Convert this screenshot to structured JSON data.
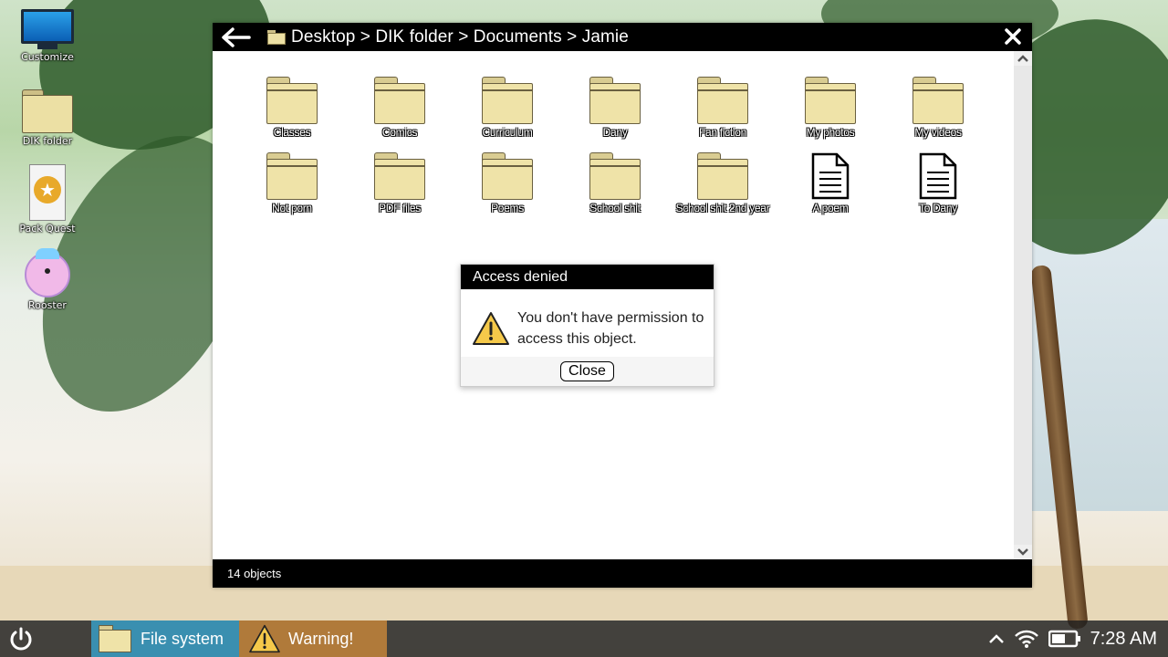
{
  "desktop": {
    "icons": [
      {
        "label": "Customize",
        "icon": "monitor-icon"
      },
      {
        "label": "DIK folder",
        "icon": "folder-icon"
      },
      {
        "label": "Pack Quest",
        "icon": "pack-quest-icon"
      },
      {
        "label": "Rooster",
        "icon": "rooster-icon"
      }
    ]
  },
  "window": {
    "breadcrumb": "Desktop > DIK folder > Documents > Jamie",
    "status": "14 objects",
    "items": [
      {
        "name": "Classes",
        "type": "folder"
      },
      {
        "name": "Comics",
        "type": "folder"
      },
      {
        "name": "Curriculum",
        "type": "folder"
      },
      {
        "name": "Dany",
        "type": "folder"
      },
      {
        "name": "Fan fiction",
        "type": "folder"
      },
      {
        "name": "My photos",
        "type": "folder"
      },
      {
        "name": "My videos",
        "type": "folder"
      },
      {
        "name": "Not porn",
        "type": "folder"
      },
      {
        "name": "PDF files",
        "type": "folder"
      },
      {
        "name": "Poems",
        "type": "folder"
      },
      {
        "name": "School shit",
        "type": "folder"
      },
      {
        "name": "School shit 2nd year",
        "type": "folder"
      },
      {
        "name": "A poem",
        "type": "document"
      },
      {
        "name": "To Dany",
        "type": "document"
      }
    ]
  },
  "dialog": {
    "title": "Access denied",
    "message": "You don't have permission to access this object.",
    "close_label": "Close"
  },
  "taskbar": {
    "tasks": [
      {
        "label": "File system",
        "icon": "folder-icon"
      },
      {
        "label": "Warning!",
        "icon": "warning-icon"
      }
    ],
    "time": "7:28 AM"
  },
  "colors": {
    "titlebar": "#000000",
    "folder_fill": "#efe3a8",
    "task_filesystem": "#3a8fb0",
    "task_warning": "#b07a3a"
  }
}
